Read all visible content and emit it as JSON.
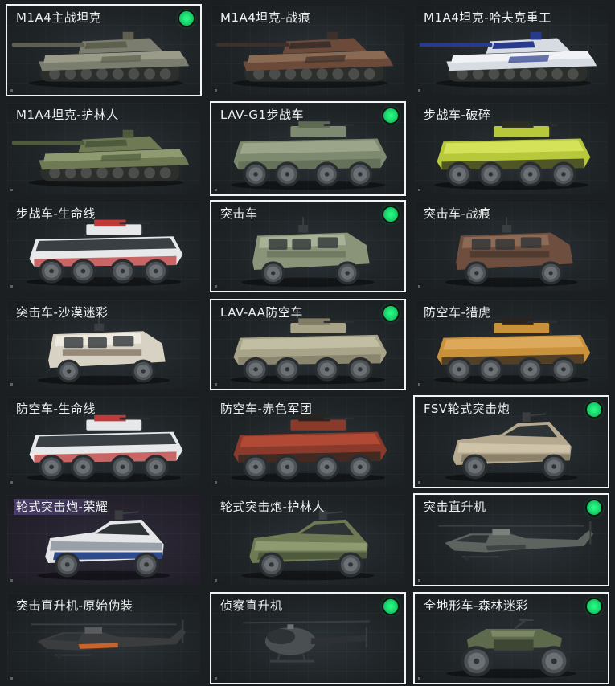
{
  "colors": {
    "owned_border": "#f2f4f4",
    "owned_badge": "#19d46a",
    "background": "#1b1f22",
    "highlight_label": "#4a3d6a"
  },
  "cards": [
    {
      "label": "M1A4主战坦克",
      "owned": true,
      "vehicle": "tank",
      "palette": [
        "#7b7e6e",
        "#5d604f",
        "#9a9b88"
      ],
      "highlight": false
    },
    {
      "label": "M1A4坦克-战痕",
      "owned": false,
      "vehicle": "tank",
      "palette": [
        "#6b4a3a",
        "#3d2f2a",
        "#8a6a52"
      ],
      "highlight": false
    },
    {
      "label": "M1A4坦克-哈夫克重工",
      "owned": false,
      "vehicle": "tank",
      "palette": [
        "#d7dbe2",
        "#283a8c",
        "#f0f2f5"
      ],
      "highlight": false
    },
    {
      "label": "M1A4坦克-护林人",
      "owned": false,
      "vehicle": "tank",
      "palette": [
        "#6f7a55",
        "#4d5a3c",
        "#8e9a70"
      ],
      "highlight": false
    },
    {
      "label": "LAV-G1步战车",
      "owned": true,
      "vehicle": "ifv",
      "palette": [
        "#7e8a70",
        "#5e6a52",
        "#9aa58a"
      ],
      "highlight": false
    },
    {
      "label": "步战车-破碎",
      "owned": false,
      "vehicle": "ifv",
      "palette": [
        "#b7c93a",
        "#2c2e1e",
        "#d4e25a"
      ],
      "highlight": false
    },
    {
      "label": "步战车-生命线",
      "owned": false,
      "vehicle": "ifv",
      "palette": [
        "#e6e8ea",
        "#c03a3a",
        "#3a3f44"
      ],
      "highlight": false
    },
    {
      "label": "突击车",
      "owned": true,
      "vehicle": "mrap",
      "palette": [
        "#8a9478",
        "#666f58",
        "#a9b297"
      ],
      "highlight": false
    },
    {
      "label": "突击车-战痕",
      "owned": false,
      "vehicle": "mrap",
      "palette": [
        "#6e4e3e",
        "#43332b",
        "#8c6a56"
      ],
      "highlight": false
    },
    {
      "label": "突击车-沙漠迷彩",
      "owned": false,
      "vehicle": "mrap",
      "palette": [
        "#d8d2c4",
        "#7a6a58",
        "#eeeae0"
      ],
      "highlight": false
    },
    {
      "label": "LAV-AA防空车",
      "owned": true,
      "vehicle": "ifv",
      "palette": [
        "#a8a48a",
        "#7f7b64",
        "#c2bea4"
      ],
      "highlight": false
    },
    {
      "label": "防空车-猎虎",
      "owned": false,
      "vehicle": "ifv",
      "palette": [
        "#c9913a",
        "#2a2420",
        "#dca85a"
      ],
      "highlight": false
    },
    {
      "label": "防空车-生命线",
      "owned": false,
      "vehicle": "ifv",
      "palette": [
        "#e6e8ea",
        "#c03a3a",
        "#3a3f44"
      ],
      "highlight": false
    },
    {
      "label": "防空车-赤色军团",
      "owned": false,
      "vehicle": "ifv",
      "palette": [
        "#8a3a2a",
        "#2a2420",
        "#b04a34"
      ],
      "highlight": false
    },
    {
      "label": "FSV轮式突击炮",
      "owned": true,
      "vehicle": "buggy",
      "palette": [
        "#b5a98f",
        "#8b8069",
        "#cfc4aa"
      ],
      "highlight": false
    },
    {
      "label": "轮式突击炮-荣耀",
      "owned": false,
      "vehicle": "buggy",
      "palette": [
        "#e4e6e8",
        "#2d4a8a",
        "#9aa0a8"
      ],
      "highlight": true
    },
    {
      "label": "轮式突击炮-护林人",
      "owned": false,
      "vehicle": "buggy",
      "palette": [
        "#6f7a55",
        "#4d5a3c",
        "#8e9a70"
      ],
      "highlight": false
    },
    {
      "label": "突击直升机",
      "owned": true,
      "vehicle": "heli",
      "palette": [
        "#5d6460",
        "#3e4441",
        "#7a817c"
      ],
      "highlight": false
    },
    {
      "label": "突击直升机-原始伪装",
      "owned": false,
      "vehicle": "heli",
      "palette": [
        "#3a3c3e",
        "#c8642a",
        "#5a5c5e"
      ],
      "highlight": false
    },
    {
      "label": "侦察直升机",
      "owned": true,
      "vehicle": "scout",
      "palette": [
        "#4a4f52",
        "#2e3235",
        "#6a7074"
      ],
      "highlight": false
    },
    {
      "label": "全地形车-森林迷彩",
      "owned": true,
      "vehicle": "atv",
      "palette": [
        "#5e6a4c",
        "#3e4634",
        "#7c8866"
      ],
      "highlight": false
    }
  ]
}
